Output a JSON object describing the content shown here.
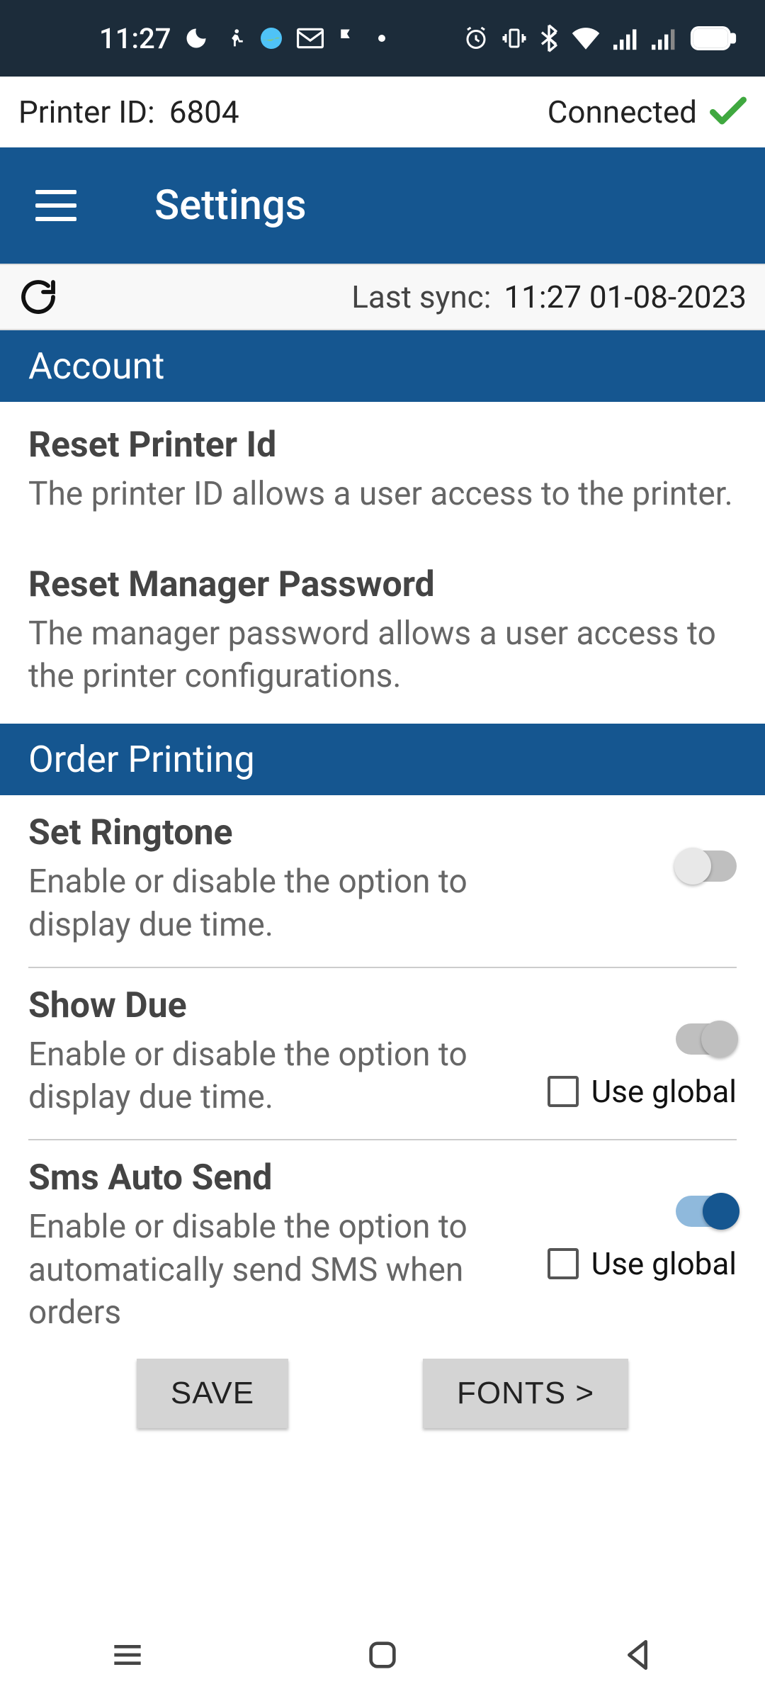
{
  "status": {
    "time": "11:27"
  },
  "printer": {
    "label": "Printer ID:",
    "id": "6804",
    "status": "Connected"
  },
  "toolbar": {
    "title": "Settings"
  },
  "sync": {
    "label": "Last sync:",
    "value": "11:27 01-08-2023"
  },
  "sections": {
    "account": {
      "header": "Account",
      "reset_printer": {
        "title": "Reset Printer Id",
        "desc": "The printer ID allows a user access to the printer."
      },
      "reset_manager": {
        "title": "Reset Manager Password",
        "desc": "The manager password allows a user access to the printer configurations."
      }
    },
    "order_printing": {
      "header": "Order Printing",
      "set_ringtone": {
        "title": "Set Ringtone",
        "desc": "Enable or disable the option to display due time."
      },
      "show_due": {
        "title": "Show Due",
        "desc": "Enable or disable the option to display due time.",
        "use_global": "Use global"
      },
      "sms_auto": {
        "title": "Sms Auto Send",
        "desc": "Enable or disable the option to automatically send SMS when orders",
        "use_global": "Use global"
      }
    }
  },
  "buttons": {
    "save": "SAVE",
    "fonts": "FONTS >"
  }
}
